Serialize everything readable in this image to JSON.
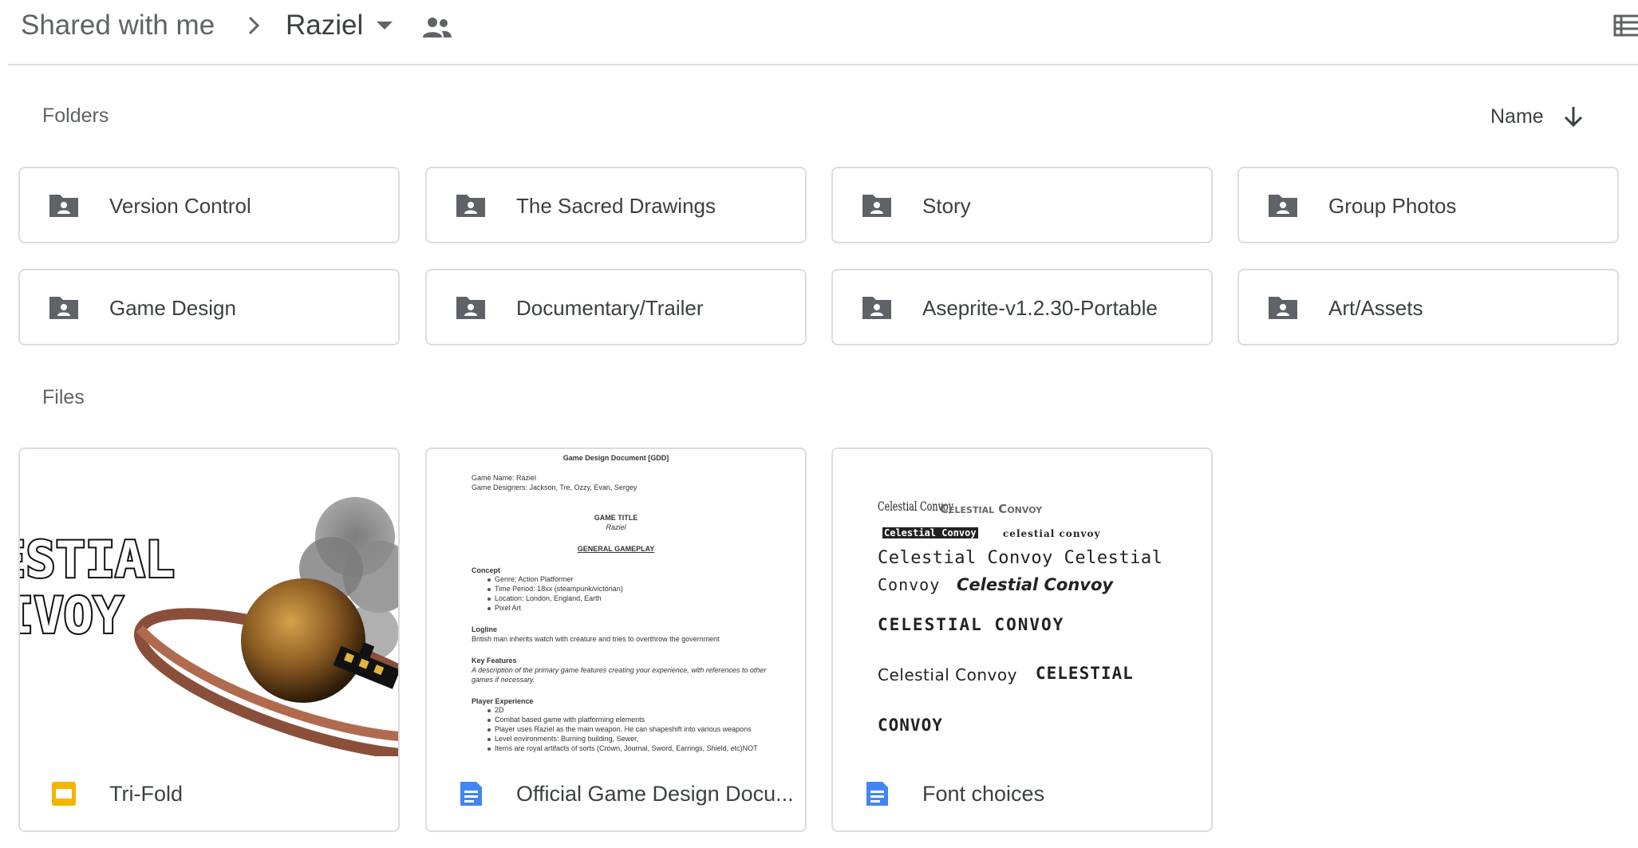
{
  "header": {
    "breadcrumb_parent": "Shared with me",
    "breadcrumb_current": "Raziel"
  },
  "icons": {
    "chevron": "chevron-right-icon",
    "caret": "caret-down-icon",
    "people": "people-icon",
    "list": "list-view-icon",
    "folder": "shared-folder-icon",
    "slides": "slides-icon",
    "docs": "docs-icon",
    "sort": "arrow-down-icon"
  },
  "colors": {
    "folder_icon": "#5f6368",
    "slides": "#f4b400",
    "docs": "#4285f4",
    "border": "#dadce0"
  },
  "sections": {
    "folders_label": "Folders",
    "files_label": "Files",
    "sort_label": "Name"
  },
  "folders": [
    {
      "name": "Version Control"
    },
    {
      "name": "The Sacred Drawings"
    },
    {
      "name": "Story"
    },
    {
      "name": "Group Photos"
    },
    {
      "name": "Game Design"
    },
    {
      "name": "Documentary/Trailer"
    },
    {
      "name": "Aseprite-v1.2.30-Portable"
    },
    {
      "name": "Art/Assets"
    }
  ],
  "files": [
    {
      "name": "Tri-Fold",
      "type": "slides",
      "thumb_text": [
        "ESTIAL",
        "IVOY"
      ]
    },
    {
      "name": "Official Game Design Docu...",
      "type": "docs",
      "doc": {
        "title": "Game Design Document [GDD]",
        "game_name": "Game Name: Raziel",
        "designers": "Game Designers: Jackson, Tre, Ozzy, Evan, Sergey",
        "game_title": "GAME TITLE",
        "game_title_sub": "Raziel",
        "gameplay": "GENERAL GAMEPLAY",
        "concept": "Concept",
        "concept_items": [
          "Genre: Action Platformer",
          "Time Period: 18xx (steampunk/victorian)",
          "Location: London, England, Earth",
          "Pixel Art"
        ],
        "logline": "Logline",
        "logline_text": "British man inherits watch with creature and tries to overthrow the government",
        "key_features": "Key Features",
        "key_features_text_1": "A description of the primary game features creating your experience, with references to other",
        "key_features_text_2": "games if necessary.",
        "player_experience": "Player Experience",
        "player_items": [
          "2D",
          "Combat based game with platforming elements",
          "Player uses Raziel as the main weapon. He can shapeshift into various weapons",
          "Level environments: Burning building, Sewer,",
          "Items are royal artifacts of sorts (Crown, Journal, Sword, Earrings, Shield, etc)NOT"
        ]
      }
    },
    {
      "name": "Font choices",
      "type": "docs",
      "samples": [
        "Celestial Convoy",
        "Celestial Convoy",
        "Celestial Convoy",
        "celestial convoy",
        "Celestial Convoy Celestial",
        "Convoy",
        "Celestial Convoy",
        "CELESTIAL CONVOY",
        "Celestial Convoy",
        "CELESTIAL",
        "CONVOY"
      ]
    }
  ]
}
